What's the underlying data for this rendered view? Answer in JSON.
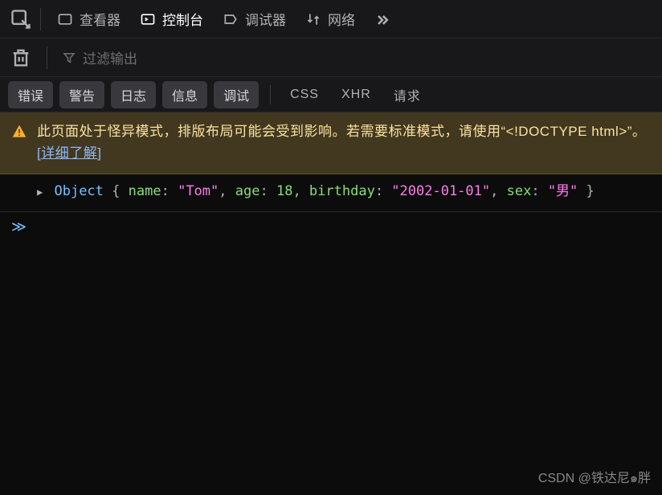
{
  "toolbar": {
    "inspector": "查看器",
    "console": "控制台",
    "debugger": "调试器",
    "network": "网络"
  },
  "filter": {
    "placeholder": "过滤输出"
  },
  "chips": {
    "error": "错误",
    "warning": "警告",
    "log": "日志",
    "info": "信息",
    "debug": "调试",
    "css": "CSS",
    "xhr": "XHR",
    "requests": "请求"
  },
  "warning": {
    "text_before": "此页面处于怪异模式，排版布局可能会受到影响。若需要标准模式，请使用“<!DOCTYPE html>”。",
    "link": "[详细了解]"
  },
  "log": {
    "prefix": "Object",
    "open": "{",
    "close": "}",
    "props": {
      "name_key": "name",
      "name_val": "\"Tom\"",
      "age_key": "age",
      "age_val": "18",
      "birthday_key": "birthday",
      "birthday_val": "\"2002-01-01\"",
      "sex_key": "sex",
      "sex_val": "\"男\""
    }
  },
  "prompt": "≫",
  "watermark": "CSDN @铁达尼๑胖"
}
